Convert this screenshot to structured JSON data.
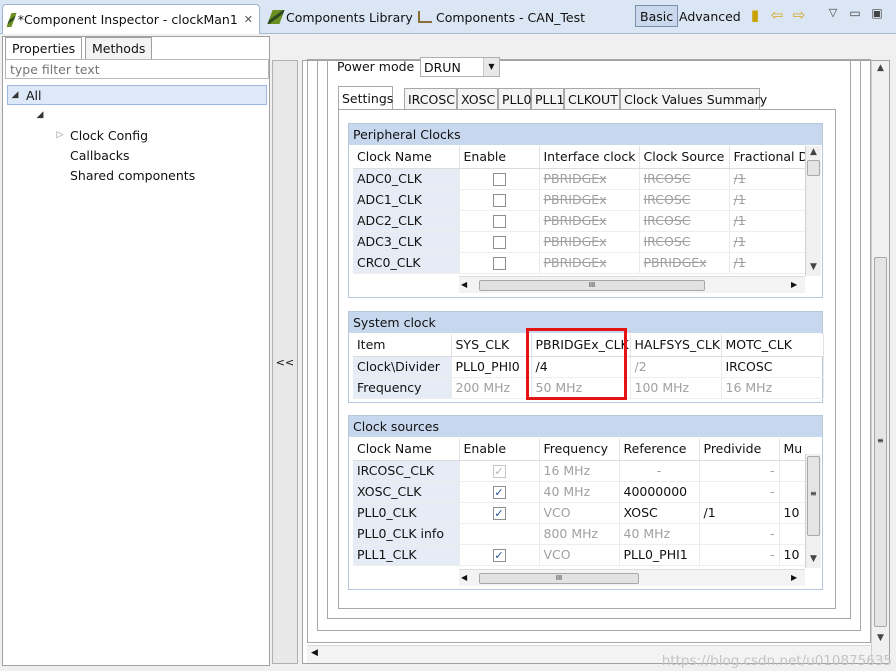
{
  "editor_tabs": [
    {
      "label": "*Component Inspector - clockMan1",
      "icon": "component-icon"
    },
    {
      "label": "Components Library",
      "icon": "components-library-icon"
    },
    {
      "label": "Components - CAN_Test",
      "icon": "components-tree-icon"
    }
  ],
  "toolbar": {
    "basic_label": "Basic",
    "advanced_label": "Advanced"
  },
  "panel_tabs": {
    "properties": "Properties",
    "methods": "Methods"
  },
  "filter": {
    "placeholder": "type filter text"
  },
  "tree": {
    "root": "All",
    "children": [
      "Clock Config",
      "Callbacks",
      "Shared components"
    ]
  },
  "collapse_label": "<<",
  "power_mode": {
    "label": "Power mode",
    "value": "DRUN"
  },
  "inner_tabs": [
    "Settings",
    "IRCOSC",
    "XOSC",
    "PLL0",
    "PLL1",
    "CLKOUT",
    "Clock Values Summary"
  ],
  "peripheral_clocks": {
    "title": "Peripheral Clocks",
    "columns": [
      "Clock Name",
      "Enable",
      "Interface clock",
      "Clock Source",
      "Fractional D"
    ],
    "rows": [
      {
        "name": "ADC0_CLK",
        "iface": "PBRIDGEx",
        "source": "IRCOSC",
        "frac": "/1"
      },
      {
        "name": "ADC1_CLK",
        "iface": "PBRIDGEx",
        "source": "IRCOSC",
        "frac": "/1"
      },
      {
        "name": "ADC2_CLK",
        "iface": "PBRIDGEx",
        "source": "IRCOSC",
        "frac": "/1"
      },
      {
        "name": "ADC3_CLK",
        "iface": "PBRIDGEx",
        "source": "IRCOSC",
        "frac": "/1"
      },
      {
        "name": "CRC0_CLK",
        "iface": "PBRIDGEx",
        "source": "PBRIDGEx",
        "frac": "/1"
      }
    ]
  },
  "system_clock": {
    "title": "System clock",
    "columns": [
      "Item",
      "SYS_CLK",
      "PBRIDGEx_CLK",
      "HALFSYS_CLK",
      "MOTC_CLK"
    ],
    "rows": [
      {
        "item": "Clock\\Divider",
        "sys": "PLL0_PHI0",
        "pbridge": "/4",
        "halfsys": "/2",
        "motc": "IRCOSC"
      },
      {
        "item": "Frequency",
        "sys": "200 MHz",
        "pbridge": "50 MHz",
        "halfsys": "100 MHz",
        "motc": "16 MHz"
      }
    ]
  },
  "clock_sources": {
    "title": "Clock sources",
    "columns": [
      "Clock Name",
      "Enable",
      "Frequency",
      "Reference",
      "Predivide",
      "Mu"
    ],
    "rows": [
      {
        "name": "IRCOSC_CLK",
        "freq": "16 MHz",
        "ref": "-",
        "pre": "-",
        "mul": "-"
      },
      {
        "name": "XOSC_CLK",
        "freq": "40 MHz",
        "ref": "40000000",
        "pre": "-",
        "mul": "-"
      },
      {
        "name": "PLL0_CLK",
        "freq": "VCO",
        "ref": "XOSC",
        "pre": "/1",
        "mul": "10"
      },
      {
        "name": "PLL0_CLK info",
        "freq": "800 MHz",
        "ref": "40 MHz",
        "pre": "-",
        "mul": "-"
      },
      {
        "name": "PLL1_CLK",
        "freq": "VCO",
        "ref": "PLL0_PHI1",
        "pre": "-",
        "mul": "10"
      }
    ]
  },
  "scroll_glyph": "III",
  "watermark": "https://blog.csdn.net/u010875635"
}
